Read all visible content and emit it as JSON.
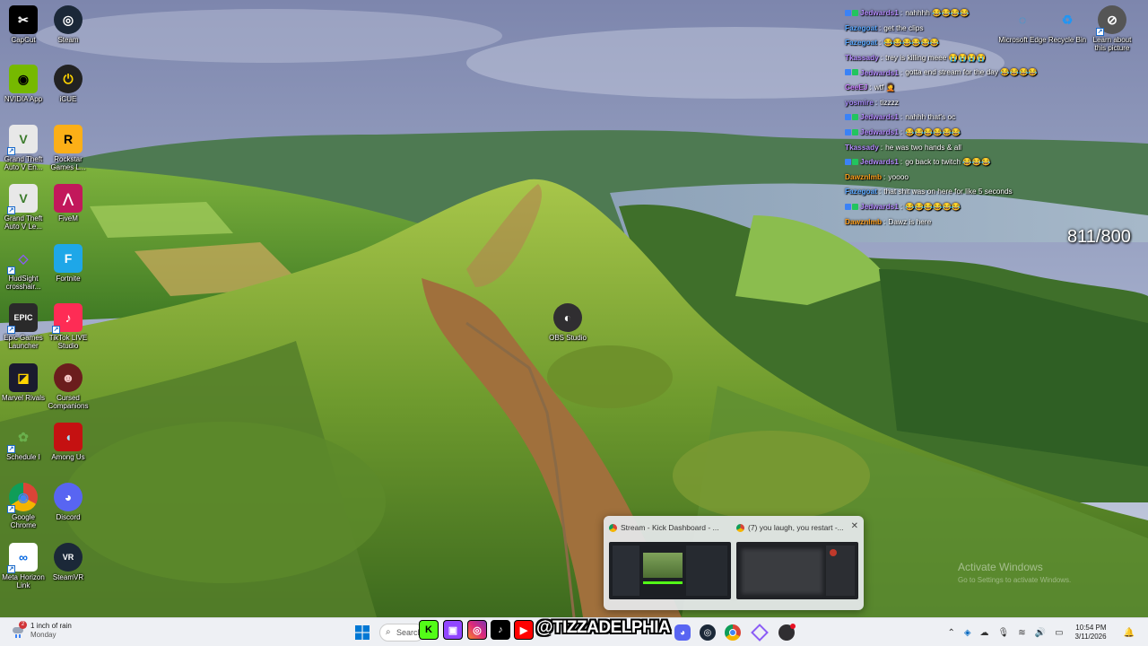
{
  "desktop": {
    "icons": [
      {
        "id": "capcut",
        "label": "CapCut"
      },
      {
        "id": "steam",
        "label": "Steam"
      },
      {
        "id": "nvidia",
        "label": "NVIDIA App"
      },
      {
        "id": "icue",
        "label": "iCUE"
      },
      {
        "id": "gta5-enhanced",
        "label": "Grand Theft Auto V En..."
      },
      {
        "id": "rockstar",
        "label": "Rockstar Games L..."
      },
      {
        "id": "gta5-legacy",
        "label": "Grand Theft Auto V Le..."
      },
      {
        "id": "fivem",
        "label": "FiveM"
      },
      {
        "id": "hudsight",
        "label": "HudSight crosshair..."
      },
      {
        "id": "fortnite",
        "label": "Fortnite"
      },
      {
        "id": "epic",
        "label": "Epic Games Launcher"
      },
      {
        "id": "tiktok-live",
        "label": "TikTok LIVE Studio"
      },
      {
        "id": "marvel",
        "label": "Marvel Rivals"
      },
      {
        "id": "cursed",
        "label": "Cursed Companions"
      },
      {
        "id": "schedule1",
        "label": "Schedule I"
      },
      {
        "id": "amongus",
        "label": "Among Us"
      },
      {
        "id": "chrome",
        "label": "Google Chrome"
      },
      {
        "id": "discord",
        "label": "Discord"
      },
      {
        "id": "meta",
        "label": "Meta Horizon Link"
      },
      {
        "id": "steamvr",
        "label": "SteamVR"
      },
      {
        "id": "obs",
        "label": "OBS Studio"
      },
      {
        "id": "edge",
        "label": "Microsoft Edge"
      },
      {
        "id": "recycle",
        "label": "Recycle Bin"
      },
      {
        "id": "learn",
        "label": "Learn about this picture"
      }
    ],
    "icon_glyphs": {
      "capcut": "✂",
      "steam": "◎",
      "nvidia": "◉",
      "icue": "⏻",
      "gta5-enhanced": "V",
      "rockstar": "R",
      "gta5-legacy": "V",
      "fivem": "⋀",
      "hudsight": "◇",
      "fortnite": "F",
      "epic": "EPIC",
      "tiktok-live": "♪",
      "marvel": "◪",
      "cursed": "☻",
      "schedule1": "✿",
      "amongus": "◖",
      "chrome": "◉",
      "discord": "◕",
      "meta": "∞",
      "steamvr": "VR",
      "obs": "◐",
      "edge": "◌",
      "recycle": "♻",
      "learn": "⊘"
    }
  },
  "chat": {
    "messages": [
      {
        "user": "Jedwards1",
        "text": "nahhhh 😂😂😂😂",
        "color": "#b48cff",
        "badges": true
      },
      {
        "user": "Fazegoat",
        "text": "get the clips",
        "color": "#5aa8ff",
        "badges": false
      },
      {
        "user": "Fazegoat",
        "text": "😂😂😂😂😂😂",
        "color": "#5aa8ff",
        "badges": false
      },
      {
        "user": "Tkassady",
        "text": "trey is killing meee 😭😭😭😭",
        "color": "#b48cff",
        "badges": false
      },
      {
        "user": "Jedwards1",
        "text": "gotta end stream for the day 😂😂😂😂",
        "color": "#b48cff",
        "badges": true
      },
      {
        "user": "CeeEJ",
        "text": "wtf 🤦",
        "color": "#c77dff",
        "badges": false
      },
      {
        "user": "yosmire",
        "text": "tizzzz",
        "color": "#a78bfa",
        "badges": false
      },
      {
        "user": "Jedwards1",
        "text": "nahhh that's oc",
        "color": "#b48cff",
        "badges": true
      },
      {
        "user": "Jedwards1",
        "text": "😂😂😂😂😂😂",
        "color": "#b48cff",
        "badges": true
      },
      {
        "user": "Tkassady",
        "text": "he was two hands & all",
        "color": "#b48cff",
        "badges": false
      },
      {
        "user": "Jedwards1",
        "text": "go back to twitch 😂😂😂",
        "color": "#b48cff",
        "badges": true
      },
      {
        "user": "Dawznlmb",
        "text": "yoooo",
        "color": "#ff9f1c",
        "badges": false
      },
      {
        "user": "Fazegoat",
        "text": "that shit was on here for like 5 seconds",
        "color": "#5aa8ff",
        "badges": false
      },
      {
        "user": "Jedwards1",
        "text": "😂😂😂😂😂😂",
        "color": "#b48cff",
        "badges": true
      },
      {
        "user": "Dawznlmb",
        "text": "Dawz is here",
        "color": "#ff9f1c",
        "badges": false
      }
    ]
  },
  "counter": "811/800",
  "preview": {
    "windows": [
      {
        "title": "Stream - Kick Dashboard - ..."
      },
      {
        "title": "(7) you laugh, you restart -..."
      }
    ]
  },
  "watermark": {
    "line1": "Activate Windows",
    "line2": "Go to Settings to activate Windows."
  },
  "taskbar": {
    "weather_badge": "2",
    "weather_line1": "1 inch of rain",
    "weather_line2": "Monday",
    "search_placeholder": "Search",
    "handle": "@TIZZADELPHIA",
    "time": "10:54 PM",
    "date": "3/11/2026"
  },
  "colors": {
    "taskbar_bg": "#eef0f4",
    "kick_green": "#53fc18",
    "twitch_purple": "#9146ff",
    "youtube_red": "#ff0000"
  }
}
